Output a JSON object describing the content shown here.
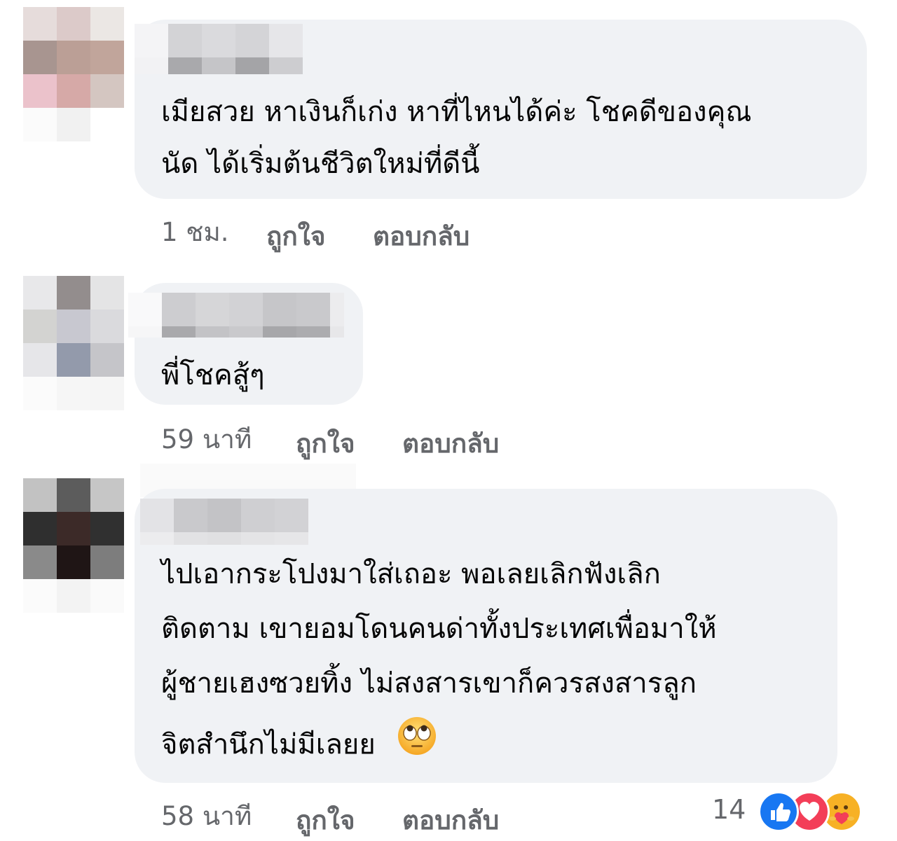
{
  "comments": [
    {
      "text_line1": "เมียสวย หาเงินก็เก่ง หาที่ไหนได้ค่ะ โชคดีของคุณ",
      "text_line2": "นัด ได้เริ่มต้นชีวิตใหม่ที่ดีนี้",
      "time": "1 ชม.",
      "like_label": "ถูกใจ",
      "reply_label": "ตอบกลับ"
    },
    {
      "text_line1": "พี่โชคสู้ๆ",
      "time": "59 นาที",
      "like_label": "ถูกใจ",
      "reply_label": "ตอบกลับ"
    },
    {
      "text_line1": "ไปเอากระโปงมาใส่เถอะ พอเลยเลิกฟังเลิก",
      "text_line2": "ติดตาม เขายอมโดนคนด่าทั้งประเทศเพื่อมาให้",
      "text_line3": "ผู้ชายเฮงซวยทิ้ง ไม่สงสารเขาก็ควรสงสารลูก",
      "text_line4": "จิตสำนึกไม่มีเลยย",
      "time": "58 นาที",
      "like_label": "ถูกใจ",
      "reply_label": "ตอบกลับ",
      "reaction_count": "14",
      "reactions": [
        "like-icon",
        "love-icon",
        "care-icon"
      ]
    }
  ],
  "colors": {
    "bubble": "#f0f2f5",
    "meta_text": "#65676b",
    "like_blue": "#1877f2",
    "love_red": "#f33e58",
    "care_yellow": "#f7b125"
  }
}
